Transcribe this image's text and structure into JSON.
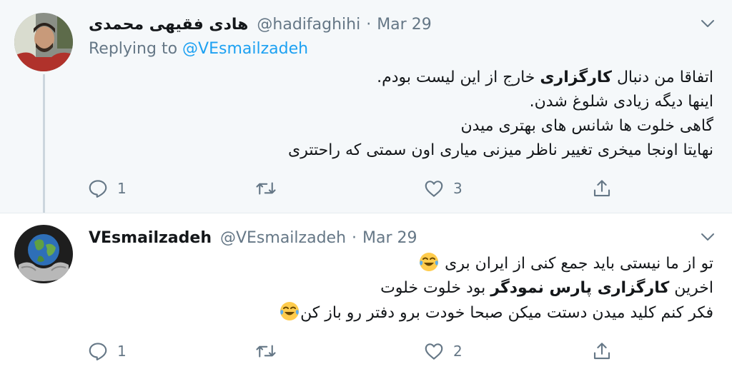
{
  "tweets": [
    {
      "display_name": "هادی فقیهی محمدی",
      "handle": "@hadifaghihi",
      "separator": "·",
      "date": "Mar 29",
      "replying_prefix": "Replying to",
      "replying_to": "@VEsmailzadeh",
      "lines": [
        {
          "pre": "اتفاقا من دنبال ",
          "bold": "کارگزاری",
          "post": " خارج از این لیست بودم."
        },
        {
          "pre": "اینها دیگه زیادی شلوغ شدن.",
          "bold": "",
          "post": ""
        },
        {
          "pre": "گاهی خلوت ها شانس های بهتری میدن",
          "bold": "",
          "post": ""
        },
        {
          "pre": "نهایتا اونجا میخری تغییر ناظر میزنی میاری اون سمتی که راحتتری",
          "bold": "",
          "post": ""
        }
      ],
      "reply_count": "1",
      "retweet_count": "",
      "like_count": "3"
    },
    {
      "display_name": "VEsmailzadeh",
      "handle": "@VEsmailzadeh",
      "separator": "·",
      "date": "Mar 29",
      "lines": [
        {
          "pre": "تو از ما نیستی باید جمع کنی از ایران بری ",
          "bold": "",
          "post": ""
        },
        {
          "pre": "اخرین ",
          "bold": "کارگزاری پارس نمودگر",
          "post": " بود خلوت خلوت"
        },
        {
          "pre": "فکر کنم کلید میدن دستت میکن صبحا خودت برو دفتر رو باز کن",
          "bold": "",
          "post": ""
        }
      ],
      "reply_count": "1",
      "retweet_count": "",
      "like_count": "2"
    }
  ],
  "icons": {
    "caret": "chevron-down-icon",
    "reply": "reply-icon",
    "retweet": "retweet-icon",
    "like": "heart-icon",
    "share": "share-icon",
    "emoji": "face-with-tears-of-joy-emoji"
  },
  "colors": {
    "link": "#1da1f2",
    "muted": "#657786",
    "text": "#14171a",
    "tweet1_bg": "#f5f8fa",
    "thread_line": "#ccd6dd"
  }
}
